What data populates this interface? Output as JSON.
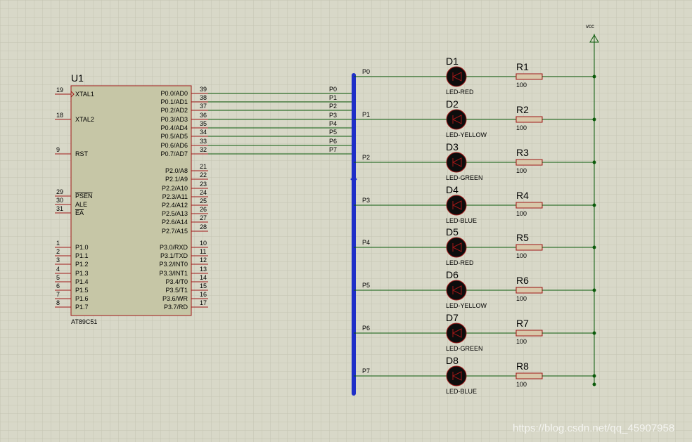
{
  "chip": {
    "ref": "U1",
    "part": "AT89C51",
    "left_pins": [
      {
        "num": "19",
        "name": "XTAL1"
      },
      {
        "num": "18",
        "name": "XTAL2"
      },
      {
        "num": "9",
        "name": "RST"
      },
      {
        "num": "29",
        "name": "PSEN"
      },
      {
        "num": "30",
        "name": "ALE"
      },
      {
        "num": "31",
        "name": "EA"
      },
      {
        "num": "1",
        "name": "P1.0"
      },
      {
        "num": "2",
        "name": "P1.1"
      },
      {
        "num": "3",
        "name": "P1.2"
      },
      {
        "num": "4",
        "name": "P1.3"
      },
      {
        "num": "5",
        "name": "P1.4"
      },
      {
        "num": "6",
        "name": "P1.5"
      },
      {
        "num": "7",
        "name": "P1.6"
      },
      {
        "num": "8",
        "name": "P1.7"
      }
    ],
    "right_pins": [
      {
        "num": "39",
        "name": "P0.0/AD0"
      },
      {
        "num": "38",
        "name": "P0.1/AD1"
      },
      {
        "num": "37",
        "name": "P0.2/AD2"
      },
      {
        "num": "36",
        "name": "P0.3/AD3"
      },
      {
        "num": "35",
        "name": "P0.4/AD4"
      },
      {
        "num": "34",
        "name": "P0.5/AD5"
      },
      {
        "num": "33",
        "name": "P0.6/AD6"
      },
      {
        "num": "32",
        "name": "P0.7/AD7"
      },
      {
        "num": "21",
        "name": "P2.0/A8"
      },
      {
        "num": "22",
        "name": "P2.1/A9"
      },
      {
        "num": "23",
        "name": "P2.2/A10"
      },
      {
        "num": "24",
        "name": "P2.3/A11"
      },
      {
        "num": "25",
        "name": "P2.4/A12"
      },
      {
        "num": "26",
        "name": "P2.5/A13"
      },
      {
        "num": "27",
        "name": "P2.6/A14"
      },
      {
        "num": "28",
        "name": "P2.7/A15"
      },
      {
        "num": "10",
        "name": "P3.0/RXD"
      },
      {
        "num": "11",
        "name": "P3.1/TXD"
      },
      {
        "num": "12",
        "name": "P3.2/INT0"
      },
      {
        "num": "13",
        "name": "P3.3/INT1"
      },
      {
        "num": "14",
        "name": "P3.4/T0"
      },
      {
        "num": "15",
        "name": "P3.5/T1"
      },
      {
        "num": "16",
        "name": "P3.6/WR"
      },
      {
        "num": "17",
        "name": "P3.7/RD"
      }
    ]
  },
  "bus_labels_in": [
    "P0",
    "P1",
    "P2",
    "P3",
    "P4",
    "P5",
    "P6",
    "P7"
  ],
  "rows": [
    {
      "net": "P0",
      "led": "D1",
      "led_type": "LED-RED",
      "res": "R1",
      "res_val": "100"
    },
    {
      "net": "P1",
      "led": "D2",
      "led_type": "LED-YELLOW",
      "res": "R2",
      "res_val": "100"
    },
    {
      "net": "P2",
      "led": "D3",
      "led_type": "LED-GREEN",
      "res": "R3",
      "res_val": "100"
    },
    {
      "net": "P3",
      "led": "D4",
      "led_type": "LED-BLUE",
      "res": "R4",
      "res_val": "100"
    },
    {
      "net": "P4",
      "led": "D5",
      "led_type": "LED-RED",
      "res": "R5",
      "res_val": "100"
    },
    {
      "net": "P5",
      "led": "D6",
      "led_type": "LED-YELLOW",
      "res": "R6",
      "res_val": "100"
    },
    {
      "net": "P6",
      "led": "D7",
      "led_type": "LED-GREEN",
      "res": "R7",
      "res_val": "100"
    },
    {
      "net": "P7",
      "led": "D8",
      "led_type": "LED-BLUE",
      "res": "R8",
      "res_val": "100"
    }
  ],
  "vcc_label": "vcc",
  "watermark": "https://blog.csdn.net/qq_45907958",
  "colors": {
    "background": "#d8d8c8",
    "grid": "#c4c4b2",
    "chip_fill": "#c6c6a6",
    "chip_border": "#a01818",
    "wire": "#0a5a0a",
    "bus": "#1e2ec8",
    "led_body": "#0d0d0d",
    "led_outline": "#a01818",
    "resistor_fill": "#d8c8aa"
  }
}
